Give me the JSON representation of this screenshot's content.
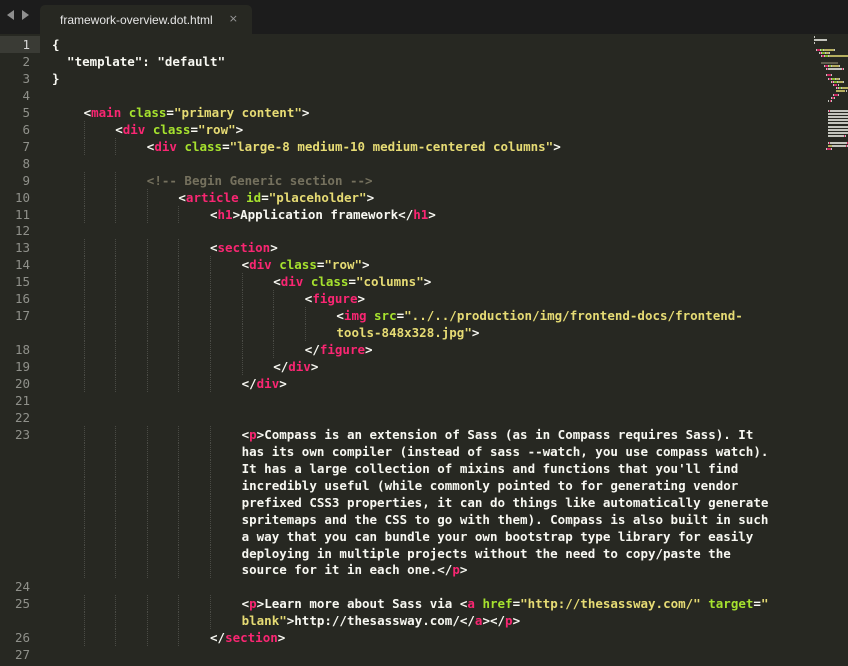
{
  "tab": {
    "title": "framework-overview.dot.html",
    "close": "×"
  },
  "colors": {
    "background": "#272822",
    "tag": "#f92672",
    "attribute": "#a6e22e",
    "string": "#e6db74",
    "comment": "#75715e",
    "text": "#f8f8f2"
  },
  "lines": [
    {
      "num": "1",
      "indent": 0,
      "tokens": [
        [
          "p",
          "{"
        ]
      ],
      "current": true
    },
    {
      "num": "2",
      "indent": 0,
      "tokens": [
        [
          "p",
          "  \"template\": \"default\""
        ]
      ]
    },
    {
      "num": "3",
      "indent": 0,
      "tokens": [
        [
          "p",
          "}"
        ]
      ]
    },
    {
      "num": "4",
      "indent": 0,
      "tokens": []
    },
    {
      "num": "5",
      "indent": 4,
      "tokens": [
        [
          "p",
          "<"
        ],
        [
          "t",
          "main"
        ],
        [
          "p",
          " "
        ],
        [
          "a",
          "class"
        ],
        [
          "p",
          "="
        ],
        [
          "s",
          "\"primary content\""
        ],
        [
          "p",
          ">"
        ]
      ]
    },
    {
      "num": "6",
      "indent": 8,
      "tokens": [
        [
          "p",
          "<"
        ],
        [
          "t",
          "div"
        ],
        [
          "p",
          " "
        ],
        [
          "a",
          "class"
        ],
        [
          "p",
          "="
        ],
        [
          "s",
          "\"row\""
        ],
        [
          "p",
          ">"
        ]
      ]
    },
    {
      "num": "7",
      "indent": 12,
      "tokens": [
        [
          "p",
          "<"
        ],
        [
          "t",
          "div"
        ],
        [
          "p",
          " "
        ],
        [
          "a",
          "class"
        ],
        [
          "p",
          "="
        ],
        [
          "s",
          "\"large-8 medium-10 medium-centered columns\""
        ],
        [
          "p",
          ">"
        ]
      ]
    },
    {
      "num": "8",
      "indent": 0,
      "tokens": []
    },
    {
      "num": "9",
      "indent": 12,
      "tokens": [
        [
          "c",
          "<!-- Begin Generic section -->"
        ]
      ]
    },
    {
      "num": "10",
      "indent": 16,
      "tokens": [
        [
          "p",
          "<"
        ],
        [
          "t",
          "article"
        ],
        [
          "p",
          " "
        ],
        [
          "a",
          "id"
        ],
        [
          "p",
          "="
        ],
        [
          "s",
          "\"placeholder\""
        ],
        [
          "p",
          ">"
        ]
      ]
    },
    {
      "num": "11",
      "indent": 20,
      "tokens": [
        [
          "p",
          "<"
        ],
        [
          "t",
          "h1"
        ],
        [
          "p",
          ">"
        ],
        [
          "x",
          "Application framework"
        ],
        [
          "p",
          "</"
        ],
        [
          "t",
          "h1"
        ],
        [
          "p",
          ">"
        ]
      ]
    },
    {
      "num": "12",
      "indent": 0,
      "tokens": []
    },
    {
      "num": "13",
      "indent": 20,
      "tokens": [
        [
          "p",
          "<"
        ],
        [
          "t",
          "section"
        ],
        [
          "p",
          ">"
        ]
      ]
    },
    {
      "num": "14",
      "indent": 24,
      "tokens": [
        [
          "p",
          "<"
        ],
        [
          "t",
          "div"
        ],
        [
          "p",
          " "
        ],
        [
          "a",
          "class"
        ],
        [
          "p",
          "="
        ],
        [
          "s",
          "\"row\""
        ],
        [
          "p",
          ">"
        ]
      ]
    },
    {
      "num": "15",
      "indent": 28,
      "tokens": [
        [
          "p",
          "<"
        ],
        [
          "t",
          "div"
        ],
        [
          "p",
          " "
        ],
        [
          "a",
          "class"
        ],
        [
          "p",
          "="
        ],
        [
          "s",
          "\"columns\""
        ],
        [
          "p",
          ">"
        ]
      ]
    },
    {
      "num": "16",
      "indent": 32,
      "tokens": [
        [
          "p",
          "<"
        ],
        [
          "t",
          "figure"
        ],
        [
          "p",
          ">"
        ]
      ]
    },
    {
      "num": "17",
      "indent": 36,
      "tokens": [
        [
          "p",
          "<"
        ],
        [
          "t",
          "img"
        ],
        [
          "p",
          " "
        ],
        [
          "a",
          "src"
        ],
        [
          "p",
          "="
        ],
        [
          "s",
          "\"../../production/img/frontend-docs/frontend-"
        ]
      ]
    },
    {
      "num": "",
      "indent": 36,
      "tokens": [
        [
          "s",
          "tools-848x328.jpg\""
        ],
        [
          "p",
          ">"
        ]
      ]
    },
    {
      "num": "18",
      "indent": 32,
      "tokens": [
        [
          "p",
          "</"
        ],
        [
          "t",
          "figure"
        ],
        [
          "p",
          ">"
        ]
      ]
    },
    {
      "num": "19",
      "indent": 28,
      "tokens": [
        [
          "p",
          "</"
        ],
        [
          "t",
          "div"
        ],
        [
          "p",
          ">"
        ]
      ]
    },
    {
      "num": "20",
      "indent": 24,
      "tokens": [
        [
          "p",
          "</"
        ],
        [
          "t",
          "div"
        ],
        [
          "p",
          ">"
        ]
      ]
    },
    {
      "num": "21",
      "indent": 0,
      "tokens": []
    },
    {
      "num": "22",
      "indent": 0,
      "tokens": []
    },
    {
      "num": "23",
      "indent": 24,
      "tokens": [
        [
          "p",
          "<"
        ],
        [
          "t",
          "p"
        ],
        [
          "p",
          ">"
        ],
        [
          "x",
          "Compass is an extension of Sass (as in Compass requires Sass). It"
        ]
      ]
    },
    {
      "num": "",
      "indent": 24,
      "tokens": [
        [
          "x",
          "has its own compiler (instead of sass --watch, you use compass watch)."
        ]
      ]
    },
    {
      "num": "",
      "indent": 24,
      "tokens": [
        [
          "x",
          "It has a large collection of mixins and functions that you'll find"
        ]
      ]
    },
    {
      "num": "",
      "indent": 24,
      "tokens": [
        [
          "x",
          "incredibly useful (while commonly pointed to for generating vendor"
        ]
      ]
    },
    {
      "num": "",
      "indent": 24,
      "tokens": [
        [
          "x",
          "prefixed CSS3 properties, it can do things like automatically generate"
        ]
      ]
    },
    {
      "num": "",
      "indent": 24,
      "tokens": [
        [
          "x",
          "spritemaps and the CSS to go with them). Compass is also built in such"
        ]
      ]
    },
    {
      "num": "",
      "indent": 24,
      "tokens": [
        [
          "x",
          "a way that you can bundle your own bootstrap type library for easily"
        ]
      ]
    },
    {
      "num": "",
      "indent": 24,
      "tokens": [
        [
          "x",
          "deploying in multiple projects without the need to copy/paste the"
        ]
      ]
    },
    {
      "num": "",
      "indent": 24,
      "tokens": [
        [
          "x",
          "source for it in each one."
        ],
        [
          "p",
          "</"
        ],
        [
          "t",
          "p"
        ],
        [
          "p",
          ">"
        ]
      ]
    },
    {
      "num": "24",
      "indent": 0,
      "tokens": []
    },
    {
      "num": "25",
      "indent": 24,
      "tokens": [
        [
          "p",
          "<"
        ],
        [
          "t",
          "p"
        ],
        [
          "p",
          ">"
        ],
        [
          "x",
          "Learn more about Sass via "
        ],
        [
          "p",
          "<"
        ],
        [
          "t",
          "a"
        ],
        [
          "p",
          " "
        ],
        [
          "a",
          "href"
        ],
        [
          "p",
          "="
        ],
        [
          "s",
          "\"http://thesassway.com/\""
        ],
        [
          "p",
          " "
        ],
        [
          "a",
          "target"
        ],
        [
          "p",
          "="
        ],
        [
          "s",
          "\""
        ]
      ]
    },
    {
      "num": "",
      "indent": 24,
      "tokens": [
        [
          "s",
          "blank\""
        ],
        [
          "p",
          ">"
        ],
        [
          "x",
          "http://thesassway.com/"
        ],
        [
          "p",
          "</"
        ],
        [
          "t",
          "a"
        ],
        [
          "p",
          "></"
        ],
        [
          "t",
          "p"
        ],
        [
          "p",
          ">"
        ]
      ]
    },
    {
      "num": "26",
      "indent": 20,
      "tokens": [
        [
          "p",
          "</"
        ],
        [
          "t",
          "section"
        ],
        [
          "p",
          ">"
        ]
      ]
    },
    {
      "num": "27",
      "indent": 0,
      "tokens": []
    }
  ]
}
